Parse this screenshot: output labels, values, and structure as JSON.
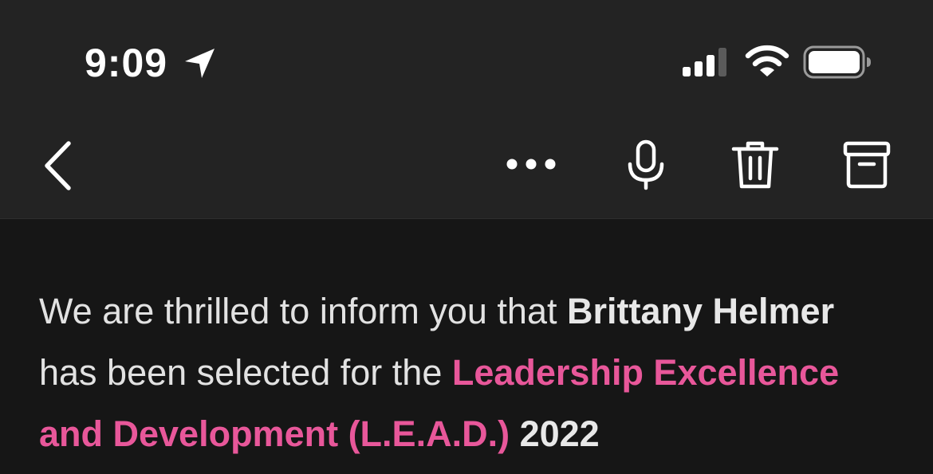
{
  "status_bar": {
    "time": "9:09",
    "icons": [
      "location-arrow-icon",
      "cellular-signal-icon",
      "wifi-icon",
      "battery-icon"
    ]
  },
  "toolbar": {
    "icons": [
      "chevron-left-icon",
      "more-dots-icon",
      "microphone-icon",
      "trash-icon",
      "archive-icon"
    ]
  },
  "message": {
    "intro": "We are thrilled to inform you that ",
    "name": "Brittany Helmer",
    "middle": " has been selected for the ",
    "program": "Leadership Excellence and Development (L.E.A.D.)",
    "year": " 2022"
  },
  "colors": {
    "background": "#161616",
    "bar": "#232323",
    "text": "#e2e2e2",
    "accent": "#e8579a"
  }
}
